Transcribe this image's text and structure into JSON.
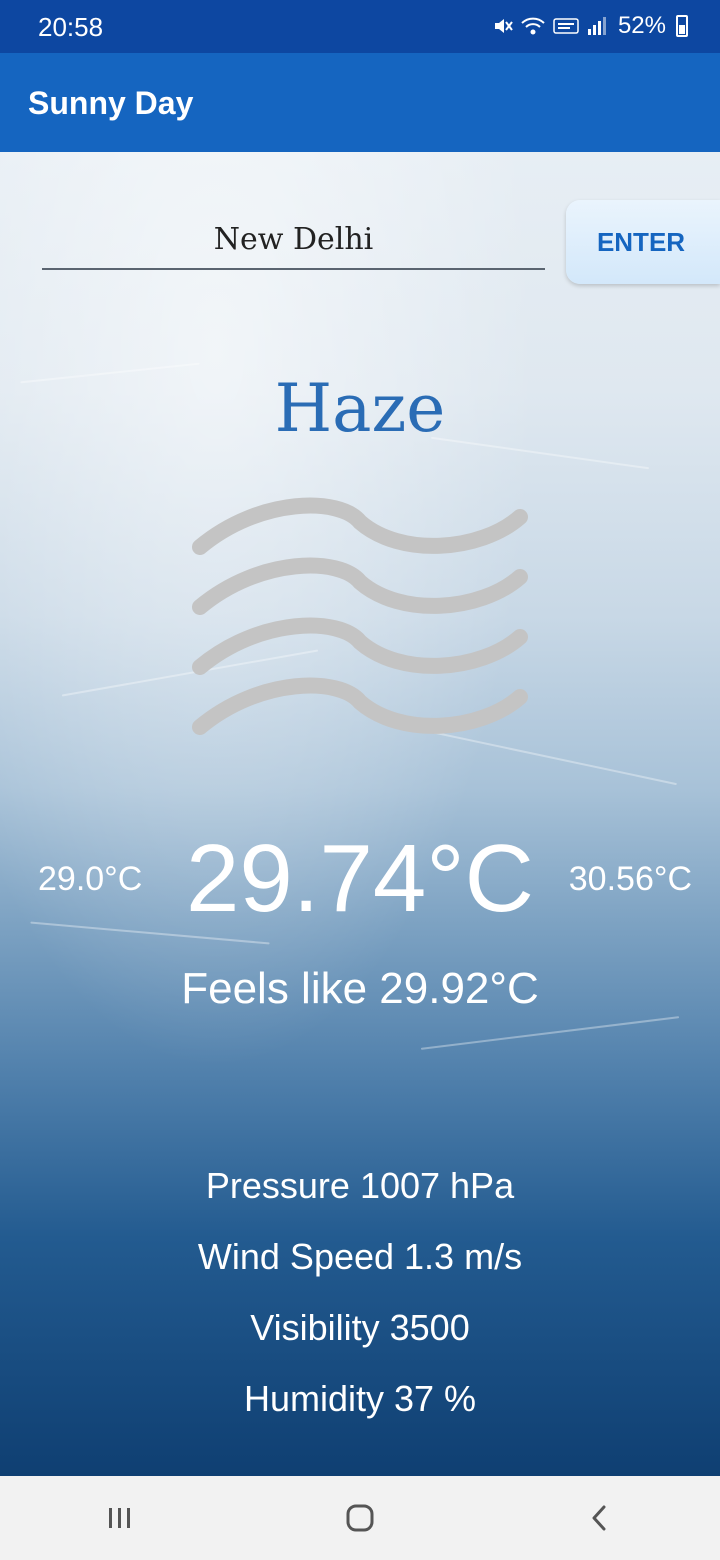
{
  "status_bar": {
    "time": "20:58",
    "battery": "52%",
    "icons": [
      "mute-icon",
      "wifi-icon",
      "volte-icon",
      "signal-icon",
      "battery-icon"
    ]
  },
  "app_bar": {
    "title": "Sunny Day"
  },
  "search": {
    "city_value": "New Delhi",
    "enter_label": "ENTER"
  },
  "weather": {
    "condition": "Haze",
    "icon": "haze-icon",
    "temp_min": "29.0°C",
    "temp_current": "29.74°C",
    "temp_max": "30.56°C",
    "feels_like": "Feels like 29.92°C"
  },
  "details": {
    "pressure": "Pressure 1007 hPa",
    "wind_speed": "Wind Speed 1.3 m/s",
    "visibility": "Visibility 3500",
    "humidity": "Humidity 37 %"
  },
  "nav": {
    "icons": [
      "recents-icon",
      "home-icon",
      "back-icon"
    ]
  },
  "colors": {
    "status_bar": "#0d47a1",
    "app_bar": "#1565c0",
    "accent": "#1565c0",
    "condition_text": "#2a6cb5",
    "haze_icon": "#c4c4c4"
  }
}
